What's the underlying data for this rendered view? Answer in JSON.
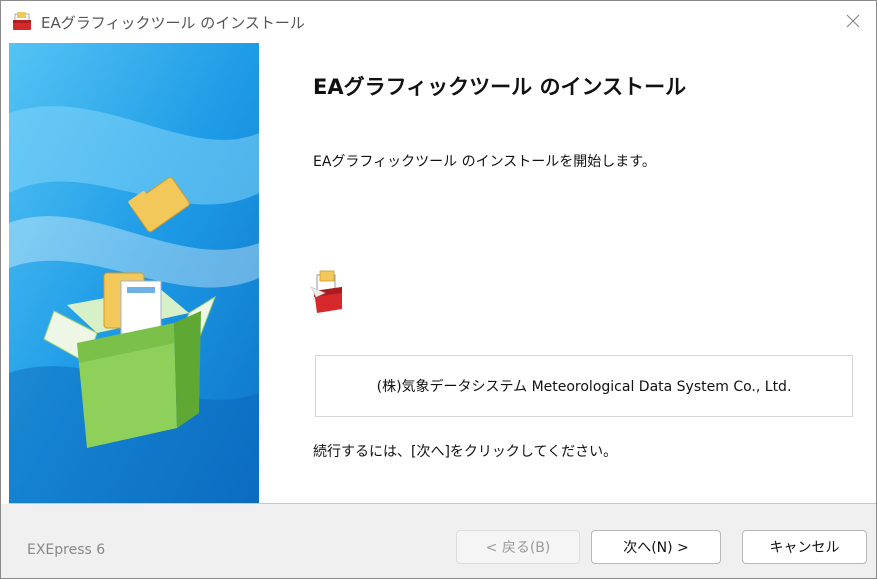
{
  "window": {
    "title": "EAグラフィックツール のインストール"
  },
  "content": {
    "heading": "EAグラフィックツール のインストール",
    "intro": "EAグラフィックツール のインストールを開始します。",
    "company": "(株)気象データシステム  Meteorological Data System Co., Ltd.",
    "continue_text": "続行するには、[次へ]をクリックしてください。"
  },
  "footer": {
    "brand": "EXEpress 6",
    "back_label": "< 戻る(B)",
    "next_label": "次へ(N) >",
    "cancel_label": "キャンセル"
  },
  "icons": {
    "title": "installer-box-icon",
    "close": "close-icon",
    "side": "open-box-with-folder-illustration",
    "content": "installer-box-icon"
  },
  "colors": {
    "panel_blue": "#1e9be6",
    "box_green": "#7cc94a",
    "folder_yellow": "#f3c85a",
    "installer_red": "#d7282c"
  }
}
